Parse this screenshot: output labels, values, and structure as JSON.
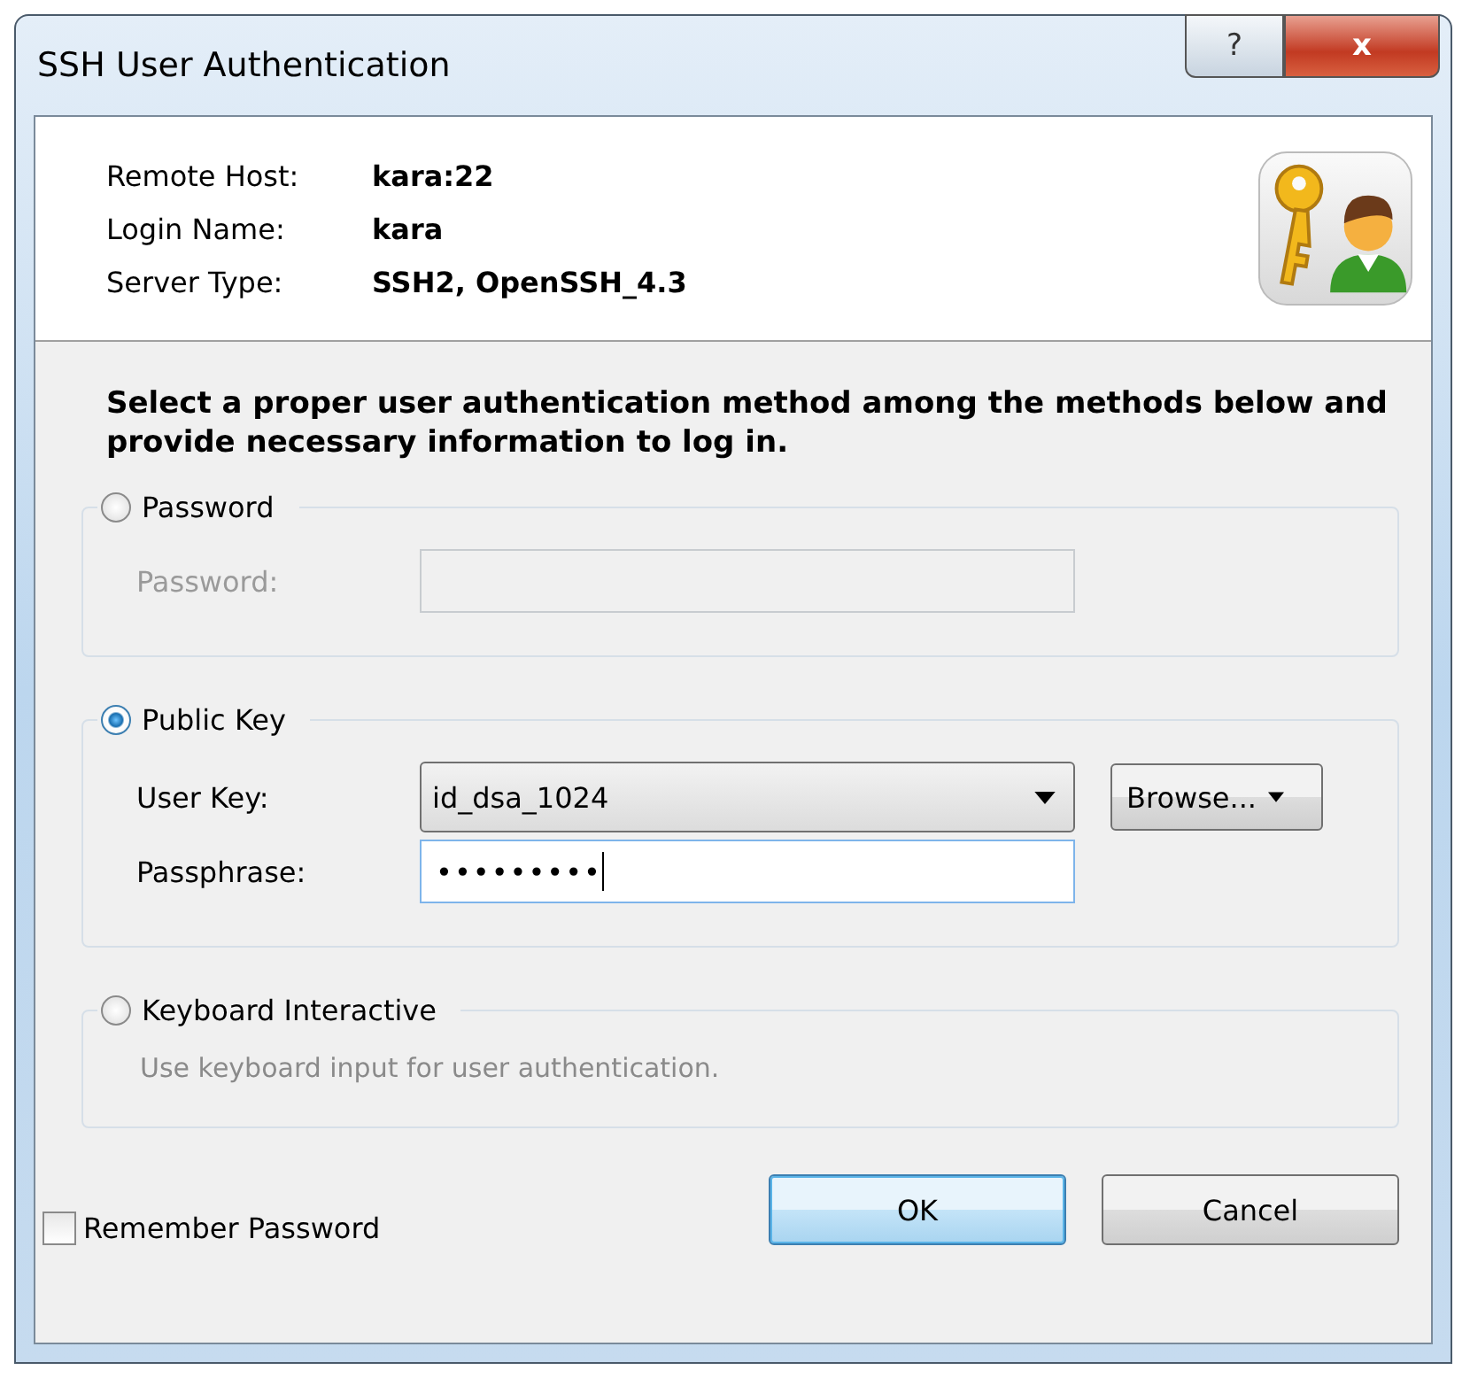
{
  "window": {
    "title": "SSH User Authentication",
    "help_button": "?",
    "close_button": "x"
  },
  "info": [
    {
      "label": "Remote Host:",
      "value": "kara:22"
    },
    {
      "label": "Login Name:",
      "value": "kara"
    },
    {
      "label": "Server Type:",
      "value": "SSH2, OpenSSH_4.3"
    }
  ],
  "instruction": "Select a proper user authentication method among the methods below and provide necessary information to log in.",
  "methods": [
    {
      "label": "Password",
      "selected": false,
      "fields": [
        {
          "kind": "text",
          "label": "Password:",
          "disabled": true,
          "focused": false
        }
      ]
    },
    {
      "label": "Public Key",
      "selected": true,
      "fields": [
        {
          "kind": "combo",
          "label": "User Key:",
          "value": "id_dsa_1024",
          "disabled": false,
          "button": "Browse..."
        },
        {
          "kind": "text",
          "label": "Passphrase:",
          "value": "•••••••••",
          "disabled": false,
          "focused": true
        }
      ]
    },
    {
      "label": "Keyboard Interactive",
      "selected": false,
      "description": "Use keyboard input for user authentication."
    }
  ],
  "remember_password": {
    "label": "Remember Password",
    "checked": false
  },
  "buttons": [
    {
      "label": "OK",
      "default": true
    },
    {
      "label": "Cancel",
      "default": false
    }
  ]
}
